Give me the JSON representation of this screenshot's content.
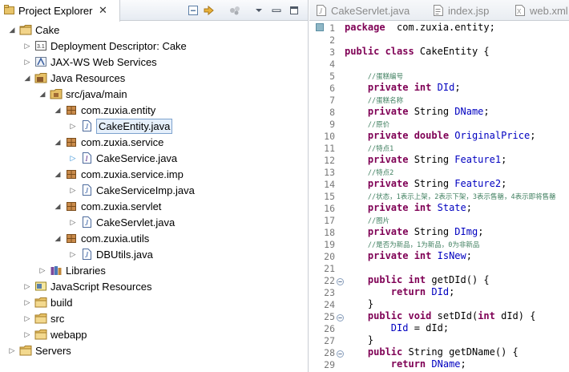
{
  "explorer": {
    "title": "Project Explorer",
    "close_glyph": "✕",
    "header_buttons": [
      "collapse-all-icon",
      "link-with-editor-icon",
      "focus-filter-icon",
      "view-menu-icon",
      "minimize-icon",
      "maximize-icon"
    ]
  },
  "tree": [
    {
      "label": "Cake",
      "icon": "project-icon",
      "state": "expanded"
    },
    {
      "label": "Deployment Descriptor: Cake",
      "icon": "deployment-descriptor-icon",
      "state": "collapsed"
    },
    {
      "label": "JAX-WS Web Services",
      "icon": "web-services-icon",
      "state": "collapsed"
    },
    {
      "label": "Java Resources",
      "icon": "java-resources-icon",
      "state": "expanded"
    },
    {
      "label": "src/java/main",
      "icon": "source-folder-icon",
      "state": "expanded"
    },
    {
      "label": "com.zuxia.entity",
      "icon": "package-icon",
      "state": "expanded"
    },
    {
      "label": "CakeEntity.java",
      "icon": "java-file-icon",
      "state": "collapsed",
      "selected": true
    },
    {
      "label": "com.zuxia.service",
      "icon": "package-icon",
      "state": "expanded"
    },
    {
      "label": "CakeService.java",
      "icon": "java-interface-icon",
      "state": "collapsed"
    },
    {
      "label": "com.zuxia.service.imp",
      "icon": "package-icon",
      "state": "expanded"
    },
    {
      "label": "CakeServiceImp.java",
      "icon": "java-file-icon",
      "state": "collapsed"
    },
    {
      "label": "com.zuxia.servlet",
      "icon": "package-icon",
      "state": "expanded"
    },
    {
      "label": "CakeServlet.java",
      "icon": "java-file-icon",
      "state": "collapsed"
    },
    {
      "label": "com.zuxia.utils",
      "icon": "package-icon",
      "state": "expanded"
    },
    {
      "label": "DBUtils.java",
      "icon": "java-file-icon",
      "state": "collapsed"
    },
    {
      "label": "Libraries",
      "icon": "libraries-icon",
      "state": "collapsed"
    },
    {
      "label": "JavaScript Resources",
      "icon": "javascript-resources-icon",
      "state": "collapsed"
    },
    {
      "label": "build",
      "icon": "folder-icon",
      "state": "collapsed"
    },
    {
      "label": "src",
      "icon": "folder-icon",
      "state": "collapsed"
    },
    {
      "label": "webapp",
      "icon": "folder-icon",
      "state": "collapsed"
    },
    {
      "label": "Servers",
      "icon": "folder-icon",
      "state": "collapsed"
    }
  ],
  "editor_tabs": [
    {
      "label": "CakeServlet.java",
      "icon": "java-file-icon"
    },
    {
      "label": "index.jsp",
      "icon": "jsp-file-icon"
    },
    {
      "label": "web.xml",
      "icon": "xml-file-icon"
    }
  ],
  "code": [
    {
      "n": "1",
      "tokens": [
        [
          "kw",
          "package"
        ],
        [
          "",
          "  com.zuxia.entity;"
        ]
      ]
    },
    {
      "n": "2",
      "tokens": []
    },
    {
      "n": "3",
      "tokens": [
        [
          "kw",
          "public class"
        ],
        [
          "",
          " CakeEntity {"
        ]
      ]
    },
    {
      "n": "4",
      "tokens": []
    },
    {
      "n": "5",
      "tokens": [
        [
          "",
          "    "
        ],
        [
          "cmt",
          "//蛋糕编号"
        ]
      ]
    },
    {
      "n": "6",
      "tokens": [
        [
          "",
          "    "
        ],
        [
          "kw",
          "private int"
        ],
        [
          "",
          " "
        ],
        [
          "fld",
          "DId"
        ],
        [
          "",
          ";"
        ]
      ]
    },
    {
      "n": "7",
      "tokens": [
        [
          "",
          "    "
        ],
        [
          "cmt",
          "//蛋糕名称"
        ]
      ]
    },
    {
      "n": "8",
      "tokens": [
        [
          "",
          "    "
        ],
        [
          "kw",
          "private"
        ],
        [
          "",
          " String "
        ],
        [
          "fld",
          "DName"
        ],
        [
          "",
          ";"
        ]
      ]
    },
    {
      "n": "9",
      "tokens": [
        [
          "",
          "    "
        ],
        [
          "cmt",
          "//原价"
        ]
      ]
    },
    {
      "n": "10",
      "tokens": [
        [
          "",
          "    "
        ],
        [
          "kw",
          "private double"
        ],
        [
          "",
          " "
        ],
        [
          "fld",
          "OriginalPrice"
        ],
        [
          "",
          ";"
        ]
      ]
    },
    {
      "n": "11",
      "tokens": [
        [
          "",
          "    "
        ],
        [
          "cmt",
          "//特点1"
        ]
      ]
    },
    {
      "n": "12",
      "tokens": [
        [
          "",
          "    "
        ],
        [
          "kw",
          "private"
        ],
        [
          "",
          " String "
        ],
        [
          "fld",
          "Feature1"
        ],
        [
          "",
          ";"
        ]
      ]
    },
    {
      "n": "13",
      "tokens": [
        [
          "",
          "    "
        ],
        [
          "cmt",
          "//特点2"
        ]
      ]
    },
    {
      "n": "14",
      "tokens": [
        [
          "",
          "    "
        ],
        [
          "kw",
          "private"
        ],
        [
          "",
          " String "
        ],
        [
          "fld",
          "Feature2"
        ],
        [
          "",
          ";"
        ]
      ]
    },
    {
      "n": "15",
      "tokens": [
        [
          "",
          "    "
        ],
        [
          "cmt",
          "//状态，1表示上架，2表示下架，3表示售罄，4表示即将售罄"
        ]
      ]
    },
    {
      "n": "16",
      "tokens": [
        [
          "",
          "    "
        ],
        [
          "kw",
          "private int"
        ],
        [
          "",
          " "
        ],
        [
          "fld",
          "State"
        ],
        [
          "",
          ";"
        ]
      ]
    },
    {
      "n": "17",
      "tokens": [
        [
          "",
          "    "
        ],
        [
          "cmt",
          "//图片"
        ]
      ]
    },
    {
      "n": "18",
      "tokens": [
        [
          "",
          "    "
        ],
        [
          "kw",
          "private"
        ],
        [
          "",
          " String "
        ],
        [
          "fld",
          "DImg"
        ],
        [
          "",
          ";"
        ]
      ]
    },
    {
      "n": "19",
      "tokens": [
        [
          "",
          "    "
        ],
        [
          "cmt",
          "//是否为新品，1为新品，0为非新品"
        ]
      ]
    },
    {
      "n": "20",
      "tokens": [
        [
          "",
          "    "
        ],
        [
          "kw",
          "private int"
        ],
        [
          "",
          " "
        ],
        [
          "fld",
          "IsNew"
        ],
        [
          "",
          ";"
        ]
      ]
    },
    {
      "n": "21",
      "tokens": []
    },
    {
      "n": "22",
      "fold": true,
      "tokens": [
        [
          "",
          "    "
        ],
        [
          "kw",
          "public int"
        ],
        [
          "",
          " getDId() {"
        ]
      ]
    },
    {
      "n": "23",
      "tokens": [
        [
          "",
          "        "
        ],
        [
          "kw",
          "return"
        ],
        [
          "",
          " "
        ],
        [
          "fld",
          "DId"
        ],
        [
          "",
          ";"
        ]
      ]
    },
    {
      "n": "24",
      "tokens": [
        [
          "",
          "    }"
        ]
      ]
    },
    {
      "n": "25",
      "fold": true,
      "tokens": [
        [
          "",
          "    "
        ],
        [
          "kw",
          "public void"
        ],
        [
          "",
          " setDId("
        ],
        [
          "kw",
          "int"
        ],
        [
          "",
          " dId) {"
        ]
      ]
    },
    {
      "n": "26",
      "tokens": [
        [
          "",
          "        "
        ],
        [
          "fld",
          "DId"
        ],
        [
          "",
          " = dId;"
        ]
      ]
    },
    {
      "n": "27",
      "tokens": [
        [
          "",
          "    }"
        ]
      ]
    },
    {
      "n": "28",
      "fold": true,
      "tokens": [
        [
          "",
          "    "
        ],
        [
          "kw",
          "public"
        ],
        [
          "",
          " String getDName() {"
        ]
      ]
    },
    {
      "n": "29",
      "tokens": [
        [
          "",
          "        "
        ],
        [
          "kw",
          "return"
        ],
        [
          "",
          " "
        ],
        [
          "fld",
          "DName"
        ],
        [
          "",
          ";"
        ]
      ]
    }
  ]
}
